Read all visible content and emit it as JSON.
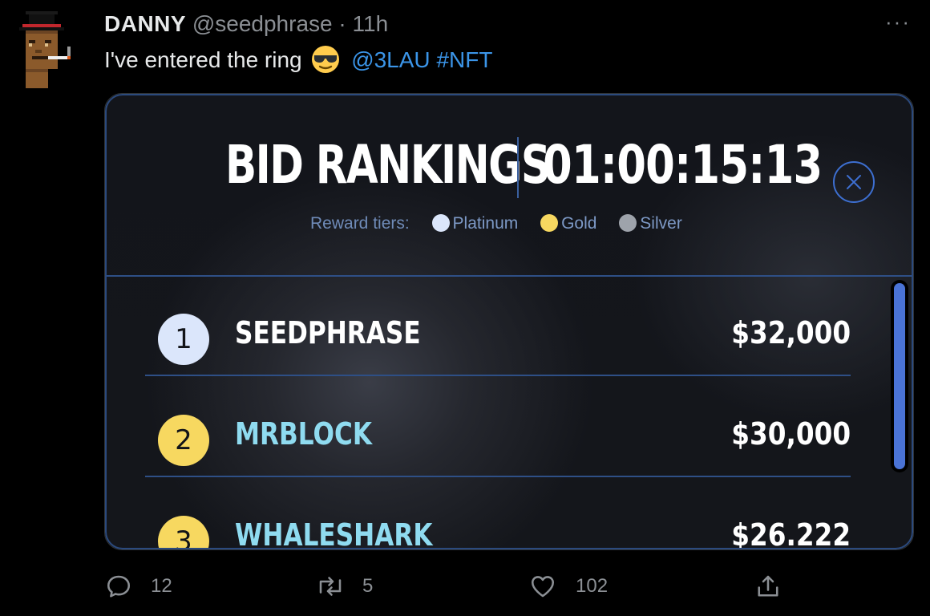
{
  "tweet": {
    "display_name": "DANNY",
    "handle": "@seedphrase",
    "separator": "·",
    "time": "11h",
    "more": "···",
    "text_before": "I've entered the ring",
    "emoji": "smiling-face-with-sunglasses",
    "mention": "@3LAU",
    "hashtag": "#NFT"
  },
  "card": {
    "title": "BID RANKINGS",
    "timer": "01:00:15:13",
    "legend_label": "Reward tiers:",
    "tiers": [
      {
        "name": "Platinum",
        "color": "#dbe6fb"
      },
      {
        "name": "Gold",
        "color": "#f7d860"
      },
      {
        "name": "Silver",
        "color": "#9ea3ab"
      }
    ],
    "rankings": [
      {
        "rank": "1",
        "name": "SEEDPHRASE",
        "amount": "$32,000",
        "badge_color": "#dbe6fb",
        "name_color": "#ffffff"
      },
      {
        "rank": "2",
        "name": "MRBLOCK",
        "amount": "$30,000",
        "badge_color": "#f7d860",
        "name_color": "#8fdbf0"
      },
      {
        "rank": "3",
        "name": "WHALESHARK",
        "amount": "$26.222",
        "badge_color": "#f7d860",
        "name_color": "#8fdbf0"
      }
    ]
  },
  "actions": {
    "reply_count": "12",
    "retweet_count": "5",
    "like_count": "102"
  },
  "colors": {
    "background": "#000000",
    "link": "#3b95e8",
    "muted": "#8b8f94",
    "accent_blue": "#3d6fd1"
  }
}
